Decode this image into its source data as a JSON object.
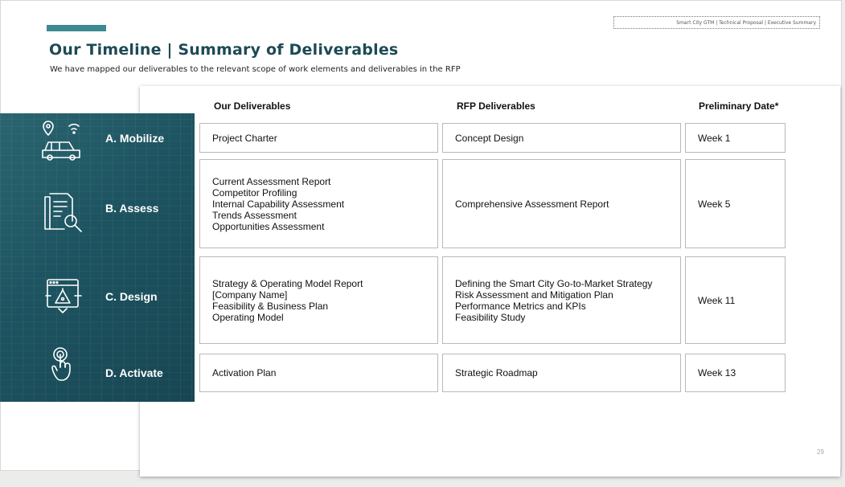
{
  "header": {
    "tag": "Smart City GTM | Technical Proposal | Executive Summary",
    "title": "Our Timeline | Summary of Deliverables",
    "subtitle": "We have mapped our deliverables to the relevant scope of work elements and deliverables in the RFP"
  },
  "columns": {
    "ours": "Our Deliverables",
    "rfp": "RFP Deliverables",
    "date": "Preliminary Date*"
  },
  "phases": [
    {
      "label": "A. Mobilize",
      "icon": "car-location-icon",
      "ours": [
        "Project Charter"
      ],
      "rfp": [
        "Concept Design"
      ],
      "date": "Week 1"
    },
    {
      "label": "B. Assess",
      "icon": "document-search-icon",
      "ours": [
        "Current Assessment Report",
        "Competitor Profiling",
        "Internal Capability Assessment",
        "Trends Assessment",
        "Opportunities Assessment"
      ],
      "rfp": [
        "Comprehensive Assessment Report"
      ],
      "date": "Week 5"
    },
    {
      "label": "C. Design",
      "icon": "design-window-icon",
      "ours": [
        "Strategy & Operating Model Report",
        "[Company Name]",
        "Feasibility & Business Plan",
        "Operating Model"
      ],
      "rfp": [
        "Defining the Smart City Go-to-Market Strategy",
        "Risk Assessment and Mitigation Plan",
        "Performance Metrics and KPIs",
        "Feasibility Study"
      ],
      "date": "Week 11"
    },
    {
      "label": "D. Activate",
      "icon": "touch-hand-icon",
      "ours": [
        "Activation Plan"
      ],
      "rfp": [
        "Strategic Roadmap"
      ],
      "date": "Week 13"
    }
  ],
  "page_number": "29",
  "colors": {
    "accent": "#3d8a91",
    "title": "#1d4a55",
    "band": "#1d5360"
  }
}
